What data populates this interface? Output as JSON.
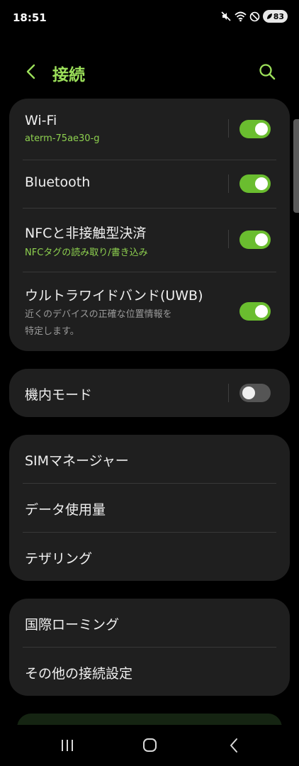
{
  "status_bar": {
    "time": "18:51",
    "battery": "83"
  },
  "header": {
    "title": "接続"
  },
  "card1": {
    "wifi": {
      "title": "Wi-Fi",
      "subtitle": "aterm-75ae30-g",
      "enabled": true
    },
    "bluetooth": {
      "title": "Bluetooth",
      "enabled": true
    },
    "nfc": {
      "title": "NFCと非接触型決済",
      "subtitle": "NFCタグの読み取り/書き込み",
      "enabled": true
    },
    "uwb": {
      "title": "ウルトラワイドバンド(UWB)",
      "subtitle_line1": "近くのデバイスの正確な位置情報を",
      "subtitle_line2": "特定します。",
      "enabled": true
    }
  },
  "card2": {
    "airplane": {
      "title": "機内モード",
      "enabled": false
    }
  },
  "card3": {
    "sim_manager": "SIMマネージャー",
    "data_usage": "データ使用量",
    "tethering": "テザリング"
  },
  "card4": {
    "roaming": "国際ローミング",
    "other_settings": "その他の接続設定"
  },
  "colors": {
    "accent": "#9ce05a",
    "toggle_on": "#6abd2f",
    "card_bg": "#1f1f1f",
    "background": "#000000"
  }
}
